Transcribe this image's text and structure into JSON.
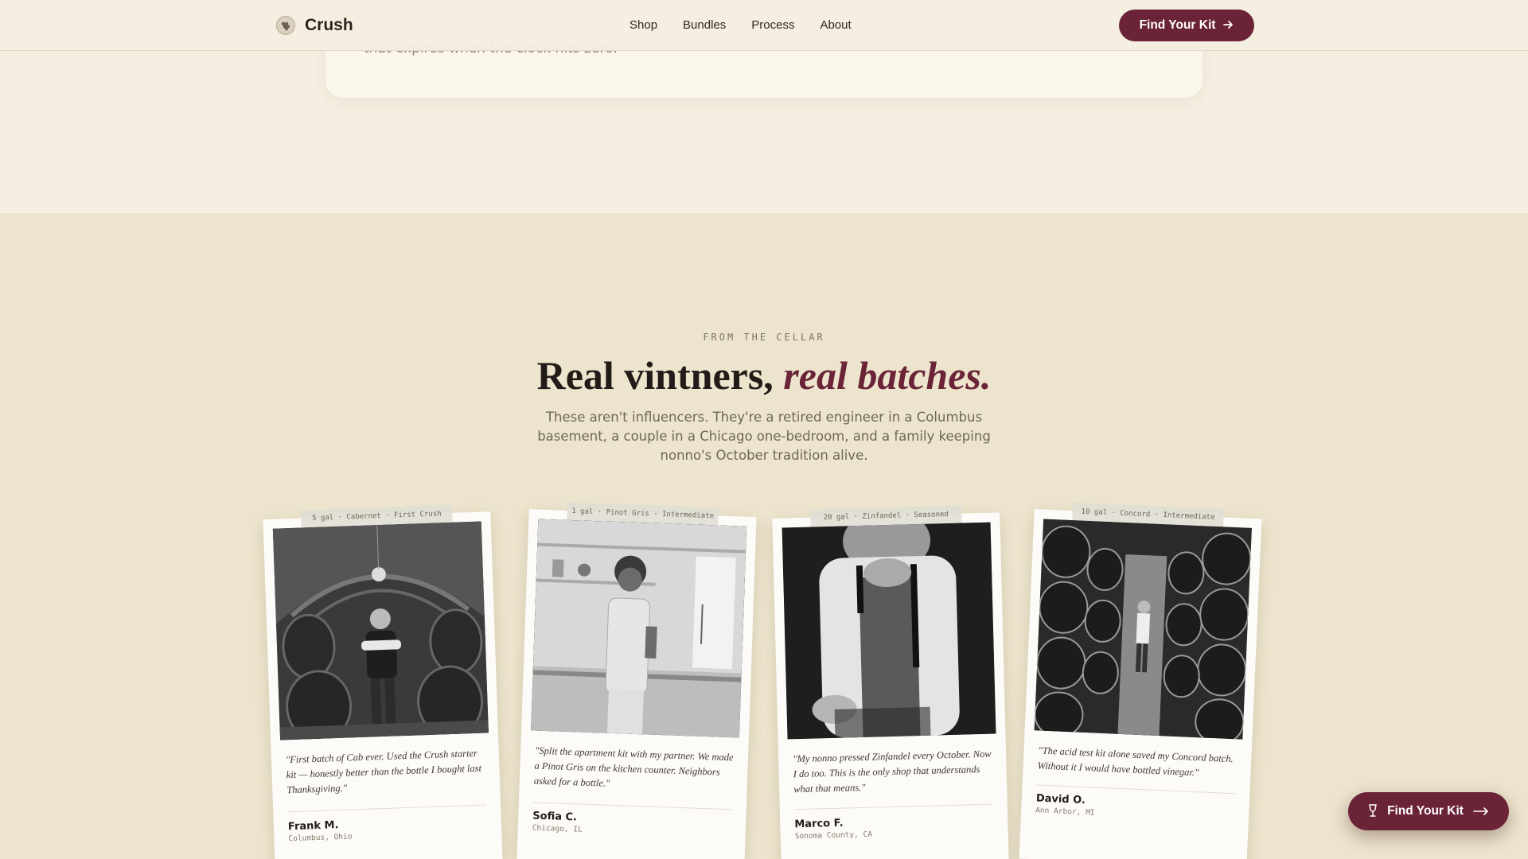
{
  "nav": {
    "brand": "Crush",
    "links": [
      "Shop",
      "Bundles",
      "Process",
      "About"
    ],
    "cta": "Find Your Kit",
    "cta_icon": "arrow-right-icon"
  },
  "previous_section": {
    "text_fragment": "that expires when the clock hits zero."
  },
  "testimonials": {
    "eyebrow": "FROM THE CELLAR",
    "headline_plain": "Real vintners,",
    "headline_accent": "real batches.",
    "subhead": "These aren't influencers. They're a retired engineer in a Columbus basement, a couple in a Chicago one-bedroom, and a family keeping nonno's October tradition alive.",
    "cards": [
      {
        "tag": "5 gal · Cabernet · First Crush",
        "quote": "\"First batch of Cab ever. Used the Crush starter kit — honestly better than the bottle I bought last Thanksgiving.\"",
        "author": "Frank M.",
        "location": "Columbus, Ohio",
        "photo": "man-in-wine-cellar-photo"
      },
      {
        "tag": "1 gal · Pinot Gris · Intermediate",
        "quote": "\"Split the apartment kit with my partner. We made a Pinot Gris on the kitchen counter. Neighbors asked for a bottle.\"",
        "author": "Sofia C.",
        "location": "Chicago, IL",
        "photo": "woman-in-kitchen-photo"
      },
      {
        "tag": "20 gal · Zinfandel · Seasoned",
        "quote": "\"My nonno pressed Zinfandel every October. Now I do too. This is the only shop that understands what that means.\"",
        "author": "Marco F.",
        "location": "Sonoma County, CA",
        "photo": "elderly-man-working-photo"
      },
      {
        "tag": "10 gal · Concord · Intermediate",
        "quote": "\"The acid test kit alone saved my Concord batch. Without it I would have bottled vinegar.\"",
        "author": "David O.",
        "location": "Ann Arbor, MI",
        "photo": "barrel-room-photo"
      }
    ]
  },
  "floating_cta": {
    "label": "Find Your Kit",
    "icon": "wine-glass-icon",
    "arrow": "long-arrow-right-icon"
  },
  "colors": {
    "accent": "#6b2338",
    "page_bg": "#ece4cc",
    "top_band": "#f5efe1"
  }
}
